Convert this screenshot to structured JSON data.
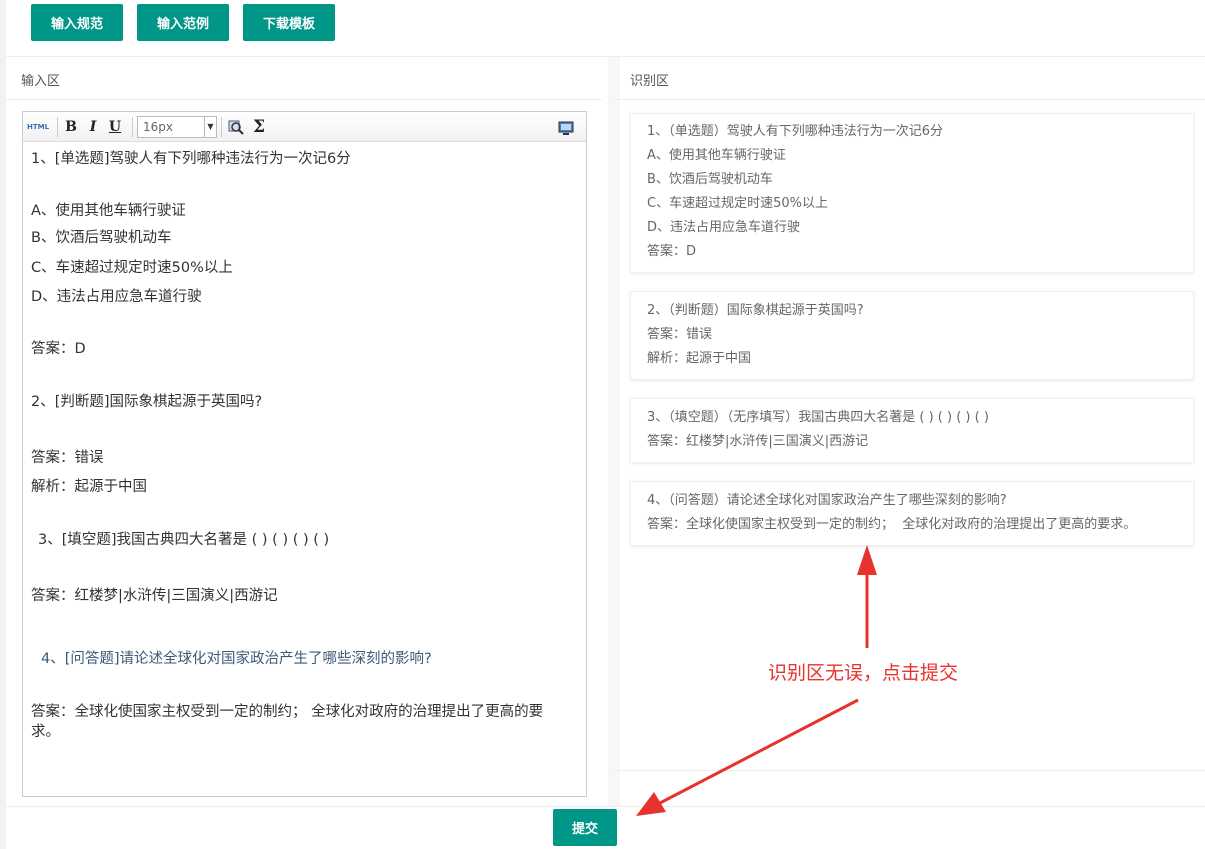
{
  "toolbar_buttons": [
    "输入规范",
    "输入范例",
    "下载模板"
  ],
  "input_panel": {
    "title": "输入区",
    "editor": {
      "font_size": "16px",
      "lines": [
        "1、[单选题]驾驶人有下列哪种违法行为一次记6分",
        "A、使用其他车辆行驶证",
        "B、饮酒后驾驶机动车",
        "C、车速超过规定时速50%以上",
        "D、违法占用应急车道行驶",
        "答案：D",
        "2、[判断题]国际象棋起源于英国吗?",
        "答案：错误",
        "解析：起源于中国",
        "3、[填空题]我国古典四大名著是 ( ) ( ) ( ) ( )",
        "答案：红楼梦|水浒传|三国演义|西游记",
        "4、[问答题]请论述全球化对国家政治产生了哪些深刻的影响?",
        "答案：全球化使国家主权受到一定的制约；  全球化对政府的治理提出了更高的要求。"
      ]
    }
  },
  "recognition_panel": {
    "title": "识别区",
    "cards": [
      {
        "lines": [
          "1、（单选题）驾驶人有下列哪种违法行为一次记6分",
          "A、使用其他车辆行驶证",
          "B、饮酒后驾驶机动车",
          "C、车速超过规定时速50%以上",
          "D、违法占用应急车道行驶",
          "答案：D"
        ]
      },
      {
        "lines": [
          "2、（判断题）国际象棋起源于英国吗?",
          "答案：错误",
          "解析：起源于中国"
        ]
      },
      {
        "lines": [
          "3、（填空题）（无序填写）我国古典四大名著是 ( ) ( ) ( ) ( )",
          "答案：红楼梦|水浒传|三国演义|西游记"
        ]
      },
      {
        "lines": [
          "4、（问答题）请论述全球化对国家政治产生了哪些深刻的影响?",
          "答案：全球化使国家主权受到一定的制约；  全球化对政府的治理提出了更高的要求。"
        ]
      }
    ]
  },
  "annotation": "识别区无误，点击提交",
  "submit_label": "提交",
  "colors": {
    "primary": "#009688",
    "annotation": "#e8322d"
  }
}
